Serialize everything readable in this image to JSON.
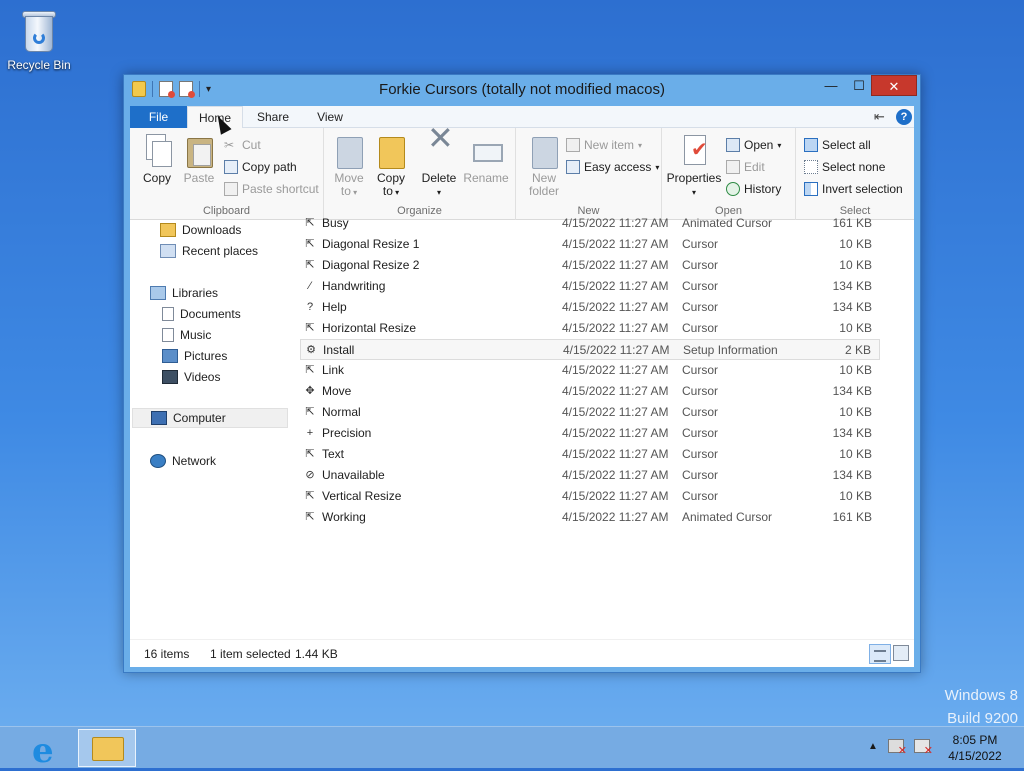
{
  "desktop": {
    "recycle_bin_label": "Recycle Bin"
  },
  "window": {
    "title": "Forkie Cursors (totally not modified macos)",
    "buttons": {
      "minimize": "—",
      "maximize": "☐",
      "close": "✕"
    }
  },
  "ribbon_tabs": {
    "file": "File",
    "home": "Home",
    "share": "Share",
    "view": "View",
    "help": "?"
  },
  "ribbon": {
    "clipboard": {
      "label": "Clipboard",
      "copy": "Copy",
      "paste": "Paste",
      "cut": "Cut",
      "copy_path": "Copy path",
      "paste_shortcut": "Paste shortcut"
    },
    "organize": {
      "label": "Organize",
      "move_to_1": "Move",
      "move_to_2": "to",
      "copy_to_1": "Copy",
      "copy_to_2": "to",
      "delete": "Delete",
      "rename": "Rename"
    },
    "new": {
      "label": "New",
      "new_folder_1": "New",
      "new_folder_2": "folder",
      "new_item": "New item",
      "easy_access": "Easy access"
    },
    "open": {
      "label": "Open",
      "properties": "Properties",
      "open": "Open",
      "edit": "Edit",
      "history": "History"
    },
    "select": {
      "label": "Select",
      "select_all": "Select all",
      "select_none": "Select none",
      "invert_selection": "Invert selection"
    }
  },
  "nav": {
    "downloads": "Downloads",
    "recent_places": "Recent places",
    "libraries": "Libraries",
    "documents": "Documents",
    "music": "Music",
    "pictures": "Pictures",
    "videos": "Videos",
    "computer": "Computer",
    "network": "Network"
  },
  "files": [
    {
      "name": "Busy",
      "date": "4/15/2022 11:27 AM",
      "type": "Animated Cursor",
      "size": "161 KB",
      "icon": "cursor-icon"
    },
    {
      "name": "Diagonal Resize 1",
      "date": "4/15/2022 11:27 AM",
      "type": "Cursor",
      "size": "10 KB",
      "icon": "cursor-icon"
    },
    {
      "name": "Diagonal Resize 2",
      "date": "4/15/2022 11:27 AM",
      "type": "Cursor",
      "size": "10 KB",
      "icon": "cursor-icon"
    },
    {
      "name": "Handwriting",
      "date": "4/15/2022 11:27 AM",
      "type": "Cursor",
      "size": "134 KB",
      "icon": "pen-cursor-icon"
    },
    {
      "name": "Help",
      "date": "4/15/2022 11:27 AM",
      "type": "Cursor",
      "size": "134 KB",
      "icon": "help-cursor-icon"
    },
    {
      "name": "Horizontal Resize",
      "date": "4/15/2022 11:27 AM",
      "type": "Cursor",
      "size": "10 KB",
      "icon": "cursor-icon"
    },
    {
      "name": "Install",
      "date": "4/15/2022 11:27 AM",
      "type": "Setup Information",
      "size": "2 KB",
      "icon": "setup-icon"
    },
    {
      "name": "Link",
      "date": "4/15/2022 11:27 AM",
      "type": "Cursor",
      "size": "10 KB",
      "icon": "cursor-icon"
    },
    {
      "name": "Move",
      "date": "4/15/2022 11:27 AM",
      "type": "Cursor",
      "size": "134 KB",
      "icon": "move-cursor-icon"
    },
    {
      "name": "Normal",
      "date": "4/15/2022 11:27 AM",
      "type": "Cursor",
      "size": "10 KB",
      "icon": "cursor-icon"
    },
    {
      "name": "Precision",
      "date": "4/15/2022 11:27 AM",
      "type": "Cursor",
      "size": "134 KB",
      "icon": "crosshair-cursor-icon"
    },
    {
      "name": "Text",
      "date": "4/15/2022 11:27 AM",
      "type": "Cursor",
      "size": "10 KB",
      "icon": "cursor-icon"
    },
    {
      "name": "Unavailable",
      "date": "4/15/2022 11:27 AM",
      "type": "Cursor",
      "size": "134 KB",
      "icon": "unavailable-cursor-icon"
    },
    {
      "name": "Vertical Resize",
      "date": "4/15/2022 11:27 AM",
      "type": "Cursor",
      "size": "10 KB",
      "icon": "cursor-icon"
    },
    {
      "name": "Working",
      "date": "4/15/2022 11:27 AM",
      "type": "Animated Cursor",
      "size": "161 KB",
      "icon": "cursor-icon"
    }
  ],
  "status": {
    "item_count": "16 items",
    "selection": "1 item selected",
    "selection_size": "1.44 KB"
  },
  "watermark": {
    "line1": "Windows 8",
    "line2": "Build 9200"
  },
  "taskbar": {
    "time": "8:05 PM",
    "date": "4/15/2022"
  }
}
